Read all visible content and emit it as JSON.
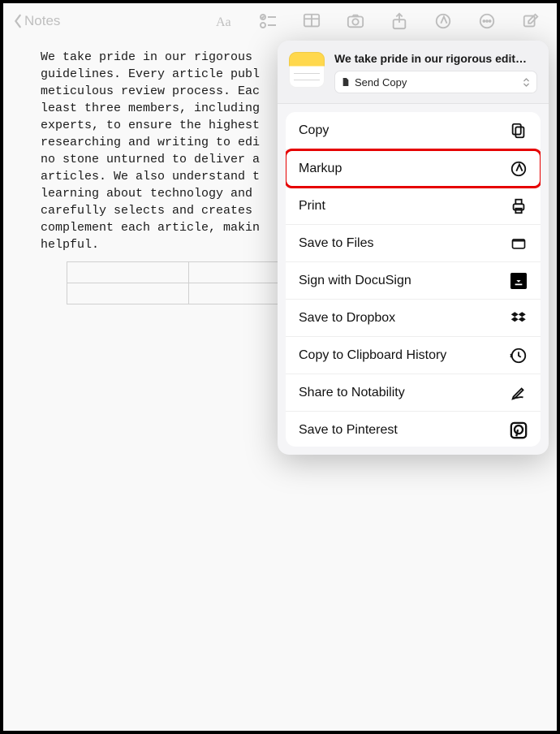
{
  "toolbar": {
    "back_label": "Notes"
  },
  "note": {
    "text": "We take pride in our rigorous\nguidelines. Every article publ\nmeticulous review process. Eac\nleast three members, including\nexperts, to ensure the highest\nresearching and writing to edi\nno stone unturned to deliver a\narticles. We also understand t\nlearning about technology and\ncarefully selects and creates\ncomplement each article, makin\nhelpful."
  },
  "share": {
    "title": "We take pride in our rigorous edit…",
    "send_copy_label": "Send Copy",
    "items": [
      {
        "label": "Copy",
        "icon": "copy-icon",
        "highlight": false
      },
      {
        "label": "Markup",
        "icon": "markup-icon",
        "highlight": true
      },
      {
        "label": "Print",
        "icon": "print-icon",
        "highlight": false
      },
      {
        "label": "Save to Files",
        "icon": "folder-icon",
        "highlight": false
      },
      {
        "label": "Sign with DocuSign",
        "icon": "docusign-icon",
        "highlight": false
      },
      {
        "label": "Save to Dropbox",
        "icon": "dropbox-icon",
        "highlight": false
      },
      {
        "label": "Copy to Clipboard History",
        "icon": "history-icon",
        "highlight": false
      },
      {
        "label": "Share to Notability",
        "icon": "pencil-icon",
        "highlight": false
      },
      {
        "label": "Save to Pinterest",
        "icon": "pinterest-icon",
        "highlight": false
      }
    ]
  }
}
